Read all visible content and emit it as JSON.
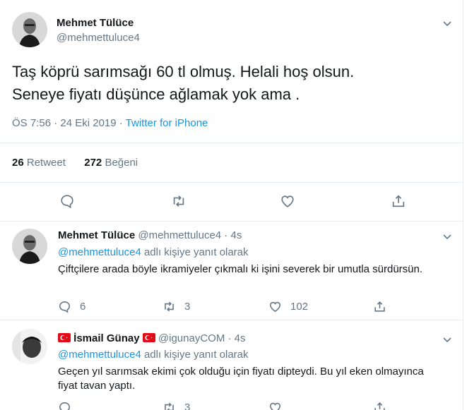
{
  "main_tweet": {
    "author_name": "Mehmet Tülüce",
    "author_handle": "@mehmettuluce4",
    "text_line1": "Taş köprü sarımsağı 60 tl olmuş. Helali hoş olsun.",
    "text_line2": "Seneye fiyatı düşünce ağlamak yok ama .",
    "time": "ÖS 7:56 · 24 Eki 2019 · ",
    "source": "Twitter for iPhone",
    "retweet_count": "26",
    "retweet_label": "Retweet",
    "like_count": "272",
    "like_label": "Beğeni"
  },
  "replies": [
    {
      "author_name": "Mehmet Tülüce",
      "author_handle": "@mehmettuluce4 · 4s",
      "reply_to_mention": "@mehmettuluce4",
      "reply_to_suffix": " adlı kişiye yanıt olarak",
      "text": "Çiftçilere arada böyle ikramiyeler çıkmalı ki işini severek bir umutla sürdürsün.",
      "reply_count": "6",
      "retweet_count": "3",
      "like_count": "102"
    },
    {
      "author_name": "İsmail Günay",
      "author_handle": "@igunayCOM · 4s",
      "reply_to_mention": "@mehmettuluce4",
      "reply_to_suffix": " adlı kişiye yanıt olarak",
      "text": "Geçen yıl sarımsak ekimi çok olduğu için fiyatı dipteydi. Bu yıl eken olmayınca fiyat tavan yaptı.",
      "reply_count": "",
      "retweet_count": "3",
      "like_count": ""
    }
  ],
  "colors": {
    "link": "#1b95e0",
    "secondary_text": "#657786",
    "divider": "#e6ecf0",
    "flag_red": "#e30a17"
  },
  "icons": [
    "chevron-down-icon",
    "reply-icon",
    "retweet-icon",
    "like-icon",
    "share-icon",
    "turkey-flag-icon"
  ]
}
